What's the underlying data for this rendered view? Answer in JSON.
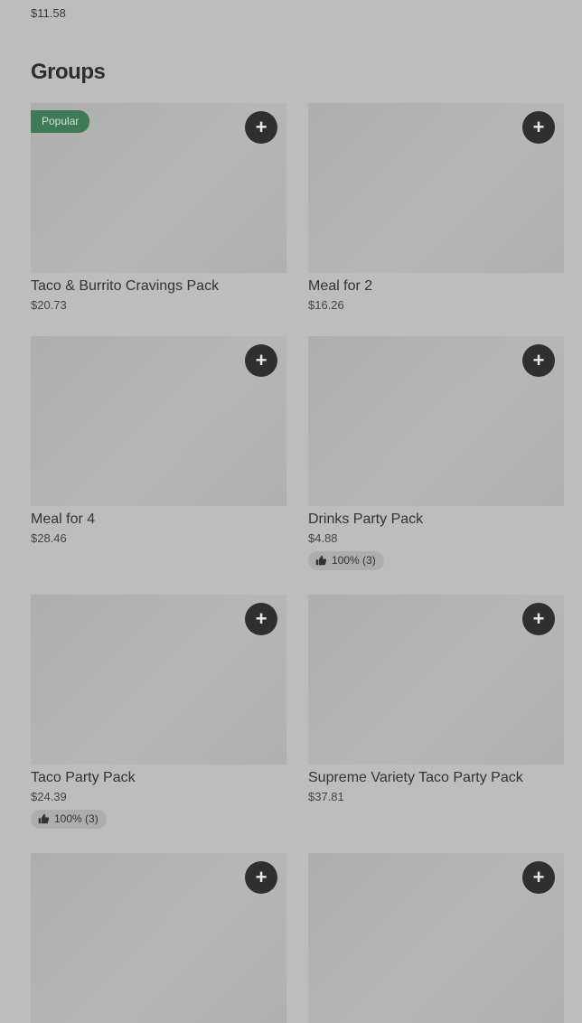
{
  "previous_section": {
    "last_price": "$11.58"
  },
  "section": {
    "title": "Groups"
  },
  "items": [
    {
      "name": "Taco & Burrito Cravings Pack",
      "price": "$20.73",
      "badge": "Popular",
      "rating": null,
      "add_label": "+"
    },
    {
      "name": "Meal for 2",
      "price": "$16.26",
      "badge": null,
      "rating": null,
      "add_label": "+"
    },
    {
      "name": "Meal for 4",
      "price": "$28.46",
      "badge": null,
      "rating": null,
      "add_label": "+"
    },
    {
      "name": "Drinks Party Pack",
      "price": "$4.88",
      "badge": null,
      "rating": "100% (3)",
      "add_label": "+"
    },
    {
      "name": "Taco Party Pack",
      "price": "$24.39",
      "badge": null,
      "rating": "100% (3)",
      "add_label": "+"
    },
    {
      "name": "Supreme Variety Taco Party Pack",
      "price": "$37.81",
      "badge": null,
      "rating": null,
      "add_label": "+"
    },
    {
      "name": "",
      "price": "",
      "badge": null,
      "rating": null,
      "add_label": "+"
    },
    {
      "name": "",
      "price": "",
      "badge": null,
      "rating": null,
      "add_label": "+"
    }
  ],
  "colors": {
    "background": "#bdbdbd",
    "badge": "#3e7a55",
    "add_button": "#2f2f2f"
  },
  "icons": {
    "add": "plus-icon",
    "rating": "thumbs-up-icon"
  }
}
